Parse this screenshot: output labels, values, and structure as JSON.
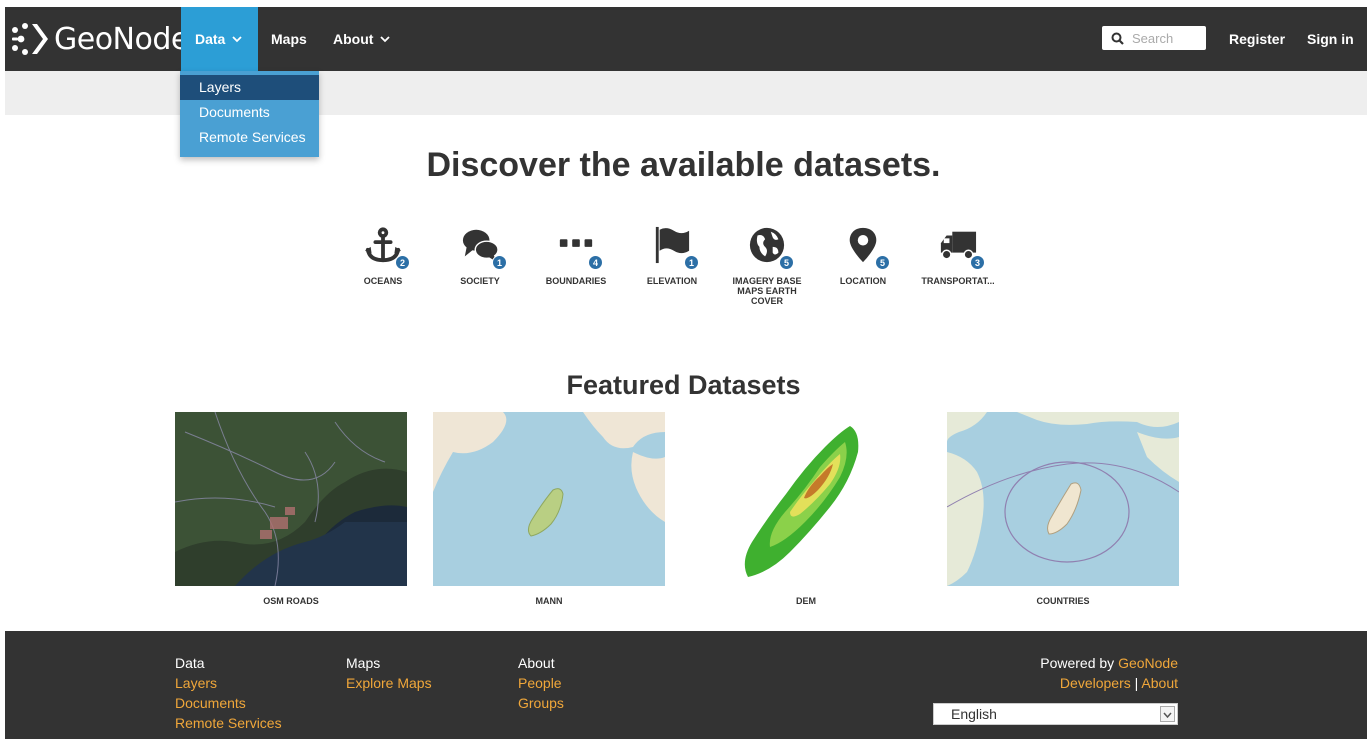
{
  "brand": {
    "name": "GeoNode"
  },
  "nav": {
    "data_label": "Data",
    "maps_label": "Maps",
    "about_label": "About",
    "search_placeholder": "Search",
    "register_label": "Register",
    "signin_label": "Sign in"
  },
  "dropdown": {
    "items": [
      "Layers",
      "Documents",
      "Remote Services"
    ]
  },
  "hero": {
    "title": "Discover the available datasets."
  },
  "categories": [
    {
      "label": "OCEANS",
      "count": "2",
      "icon": "anchor-icon"
    },
    {
      "label": "SOCIETY",
      "count": "1",
      "icon": "comments-icon"
    },
    {
      "label": "BOUNDARIES",
      "count": "4",
      "icon": "ellipsis-icon"
    },
    {
      "label": "ELEVATION",
      "count": "1",
      "icon": "flag-icon"
    },
    {
      "label": "IMAGERY BASE MAPS EARTH COVER",
      "count": "5",
      "icon": "globe-icon"
    },
    {
      "label": "LOCATION",
      "count": "5",
      "icon": "map-marker-icon"
    },
    {
      "label": "TRANSPORTAT...",
      "count": "3",
      "icon": "truck-icon"
    }
  ],
  "featured": {
    "title": "Featured Datasets",
    "items": [
      {
        "caption": "OSM ROADS"
      },
      {
        "caption": "MANN"
      },
      {
        "caption": "DEM"
      },
      {
        "caption": "COUNTRIES"
      }
    ]
  },
  "footer": {
    "col1": {
      "heading": "Data",
      "links": [
        "Layers",
        "Documents",
        "Remote Services"
      ]
    },
    "col2": {
      "heading": "Maps",
      "links": [
        "Explore Maps"
      ]
    },
    "col3": {
      "heading": "About",
      "links": [
        "People",
        "Groups"
      ]
    },
    "powered_prefix": "Powered by",
    "powered_link": "GeoNode",
    "developers": "Developers",
    "separator": "|",
    "about": "About",
    "language": "English"
  },
  "colors": {
    "navbar": "#333333",
    "accent": "#2c9ed6",
    "link": "#f0a73a",
    "badge": "#2c6fa6"
  }
}
